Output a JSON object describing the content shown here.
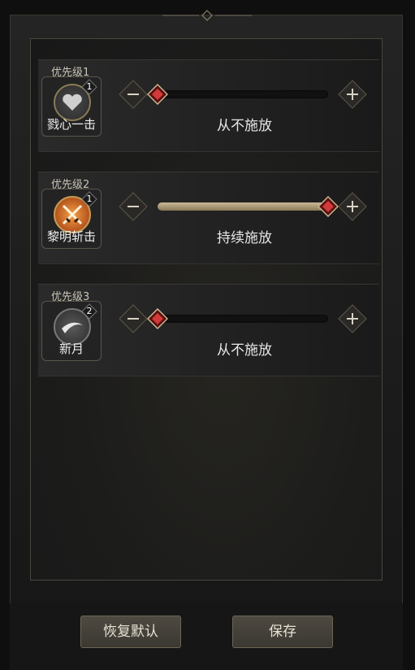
{
  "skills": [
    {
      "priority": "优先级1",
      "name": "戮心一击",
      "badge": "1",
      "status": "从不施放",
      "icon": "heart-icon",
      "level": 0.0
    },
    {
      "priority": "优先级2",
      "name": "黎明斩击",
      "badge": "1",
      "status": "持续施放",
      "icon": "crossed-swords-icon",
      "level": 1.0
    },
    {
      "priority": "优先级3",
      "name": "新月",
      "badge": "2",
      "status": "从不施放",
      "icon": "crescent-icon",
      "level": 0.0
    }
  ],
  "buttons": {
    "reset_label": "恢复默认",
    "save_label": "保存"
  },
  "colors": {
    "accent": "#d23a3a",
    "track_fill": "#b3a27c",
    "panel_bg": "#1f1f1f",
    "border": "#4a463e"
  }
}
